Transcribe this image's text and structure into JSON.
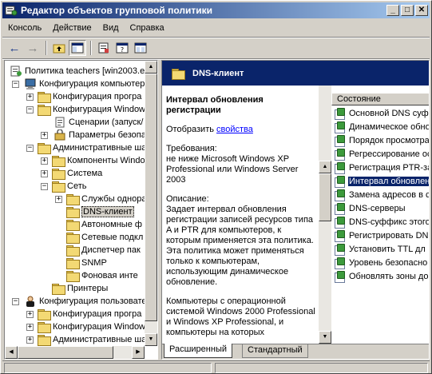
{
  "window": {
    "title": "Редактор объектов групповой политики",
    "minimize_glyph": "_",
    "maximize_glyph": "□",
    "close_glyph": "✕"
  },
  "menu": [
    {
      "label": "Консоль"
    },
    {
      "label": "Действие"
    },
    {
      "label": "Вид"
    },
    {
      "label": "Справка"
    }
  ],
  "toolbar": {
    "back_glyph": "←",
    "forward_glyph": "→",
    "icons": [
      "up-folder-icon",
      "show-tree-icon",
      "properties-icon",
      "help-icon",
      "export-list-icon"
    ]
  },
  "tree": {
    "items": [
      {
        "label": "Политика teachers [win2003.e"
      },
      {
        "label": "Конфигурация компьютера"
      },
      {
        "label": "Конфигурация програ"
      },
      {
        "label": "Конфигурация Window"
      },
      {
        "label": "Сценарии (запуск/"
      },
      {
        "label": "Параметры безопа"
      },
      {
        "label": "Административные ша"
      },
      {
        "label": "Компоненты Windo"
      },
      {
        "label": "Система"
      },
      {
        "label": "Сеть"
      },
      {
        "label": "Службы одноран"
      },
      {
        "label": "DNS-клиент"
      },
      {
        "label": "Автономные ф"
      },
      {
        "label": "Сетевые подкл"
      },
      {
        "label": "Диспетчер пак"
      },
      {
        "label": "SNMP"
      },
      {
        "label": "Фоновая инте"
      },
      {
        "label": "Принтеры"
      },
      {
        "label": "Конфигурация пользовате"
      },
      {
        "label": "Конфигурация програ"
      },
      {
        "label": "Конфигурация Window"
      },
      {
        "label": "Административные ша"
      }
    ]
  },
  "details": {
    "header": "DNS-клиент",
    "policy_title": "Интервал обновления регистрации",
    "show_prefix": "Отобразить",
    "show_link": "свойства",
    "requirements": "Требования:\nне ниже Microsoft Windows XP Professional или Windows Server 2003",
    "description": "Описание:\nЗадает интервал обновления регистрации записей ресурсов типа A и PTR для компьютеров, к которым применяется эта политика. Эта политика может применяться только к компьютерам, использующим динамическое обновление.",
    "description2": "Компьютеры с операционной системой Windows 2000 Professional и Windows XP Professional, и компьютеры на которых"
  },
  "list": {
    "column": "Состояние",
    "items": [
      {
        "label": "Основной DNS суфф"
      },
      {
        "label": "Динамическое обно"
      },
      {
        "label": "Порядок просмотра"
      },
      {
        "label": "Регрессирование ос"
      },
      {
        "label": "Регистрация PTR-за"
      },
      {
        "label": "Интервал обновлен",
        "selected": true
      },
      {
        "label": "Замена адресов в с"
      },
      {
        "label": "DNS-серверы"
      },
      {
        "label": "DNS-суффикс этого"
      },
      {
        "label": "Регистрировать DN"
      },
      {
        "label": "Установить TTL дл"
      },
      {
        "label": "Уровень безопасно"
      },
      {
        "label": "Обновлять зоны до"
      }
    ]
  },
  "tabs": [
    {
      "label": "Расширенный",
      "active": true
    },
    {
      "label": "Стандартный",
      "active": false
    }
  ],
  "colors": {
    "title_start": "#0a246a",
    "title_end": "#a6caf0",
    "selection": "#0a246a",
    "face": "#d4d0c8"
  }
}
